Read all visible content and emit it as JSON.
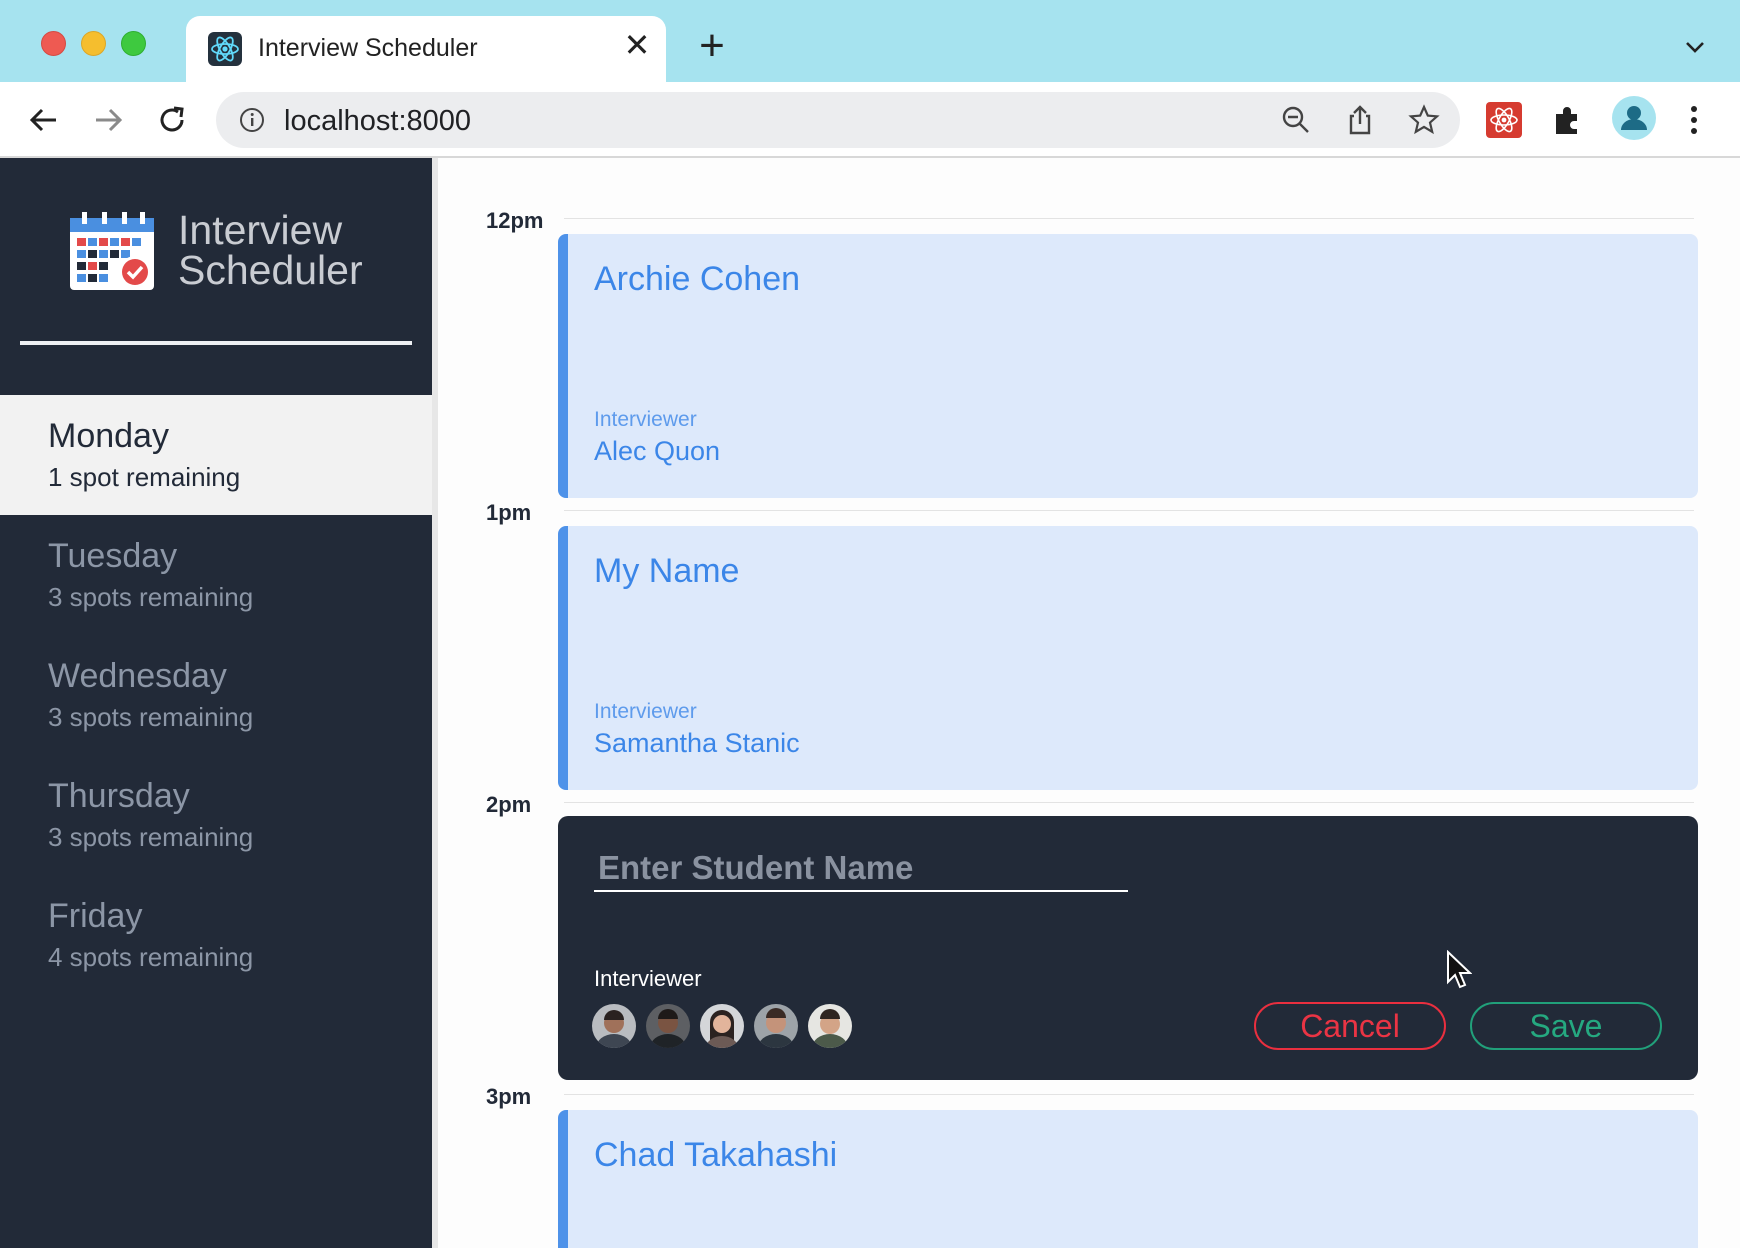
{
  "browser": {
    "tab_title": "Interview Scheduler",
    "url": "localhost:8000"
  },
  "app": {
    "logo_line1": "Interview",
    "logo_line2": "Scheduler"
  },
  "days": [
    {
      "name": "Monday",
      "spots": "1 spot remaining",
      "selected": true
    },
    {
      "name": "Tuesday",
      "spots": "3 spots remaining",
      "selected": false
    },
    {
      "name": "Wednesday",
      "spots": "3 spots remaining",
      "selected": false
    },
    {
      "name": "Thursday",
      "spots": "3 spots remaining",
      "selected": false
    },
    {
      "name": "Friday",
      "spots": "4 spots remaining",
      "selected": false
    }
  ],
  "schedule": {
    "times": [
      "12pm",
      "1pm",
      "2pm",
      "3pm"
    ],
    "appointments": [
      {
        "student": "Archie Cohen",
        "label": "Interviewer",
        "interviewer": "Alec Quon"
      },
      {
        "student": "My Name",
        "label": "Interviewer",
        "interviewer": "Samantha Stanic"
      },
      {
        "student": "Chad Takahashi"
      }
    ],
    "form": {
      "placeholder": "Enter Student Name",
      "value": "",
      "interviewer_label": "Interviewer",
      "cancel": "Cancel",
      "save": "Save",
      "avatar_count": 5
    }
  },
  "colors": {
    "sidebar": "#222a38",
    "appointment_bg": "#dde9fb",
    "appointment_accent": "#4e92e9",
    "cancel": "#ea3444",
    "save": "#25a980"
  }
}
